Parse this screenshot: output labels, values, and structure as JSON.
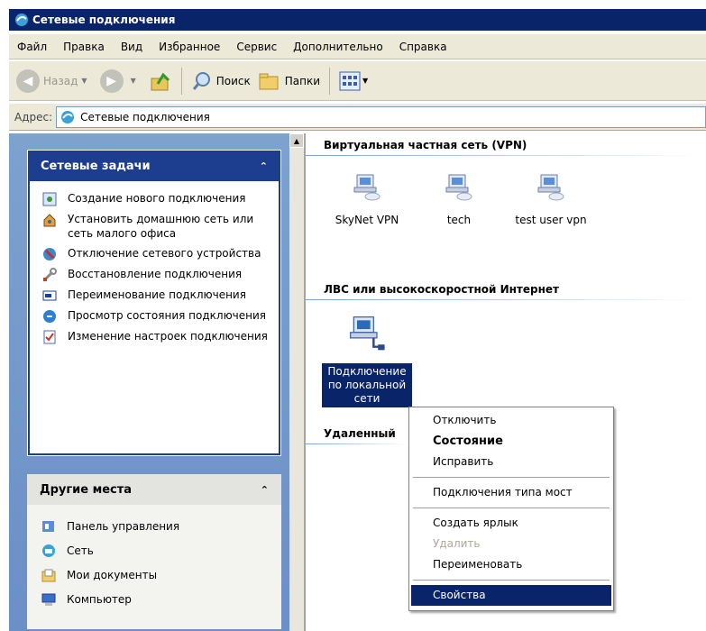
{
  "window": {
    "title": "Сетевые подключения"
  },
  "menu": [
    "Файл",
    "Правка",
    "Вид",
    "Избранное",
    "Сервис",
    "Дополнительно",
    "Справка"
  ],
  "toolbar": {
    "back": "Назад",
    "search": "Поиск",
    "folders": "Папки"
  },
  "address": {
    "label": "Адрес:",
    "value": "Сетевые подключения"
  },
  "tasks": {
    "title": "Сетевые задачи",
    "items": [
      "Создание нового подключения",
      "Установить домашнюю сеть или сеть малого офиса",
      "Отключение сетевого устройства",
      "Восстановление подключения",
      "Переименование подключения",
      "Просмотр состояния подключения",
      "Изменение настроек подключения"
    ]
  },
  "places": {
    "title": "Другие места",
    "items": [
      "Панель управления",
      "Сеть",
      "Мои документы",
      "Компьютер"
    ]
  },
  "groups": {
    "vpn": "Виртуальная частная сеть (VPN)",
    "lan": "ЛВС или высокоскоростной Интернет",
    "remote": "Удаленный"
  },
  "connections": {
    "vpn": [
      "SkyNet VPN",
      "tech",
      "test user vpn"
    ],
    "lan": "Подключение по локальной сети"
  },
  "context_menu": {
    "disconnect": "Отключить",
    "status": "Состояние",
    "repair": "Исправить",
    "bridge": "Подключения типа мост",
    "shortcut": "Создать ярлык",
    "delete": "Удалить",
    "rename": "Переименовать",
    "properties": "Свойства"
  },
  "colors": {
    "titlebar": "#0a246a",
    "taskpane": "#7da2ce",
    "selection": "#0a246a"
  }
}
